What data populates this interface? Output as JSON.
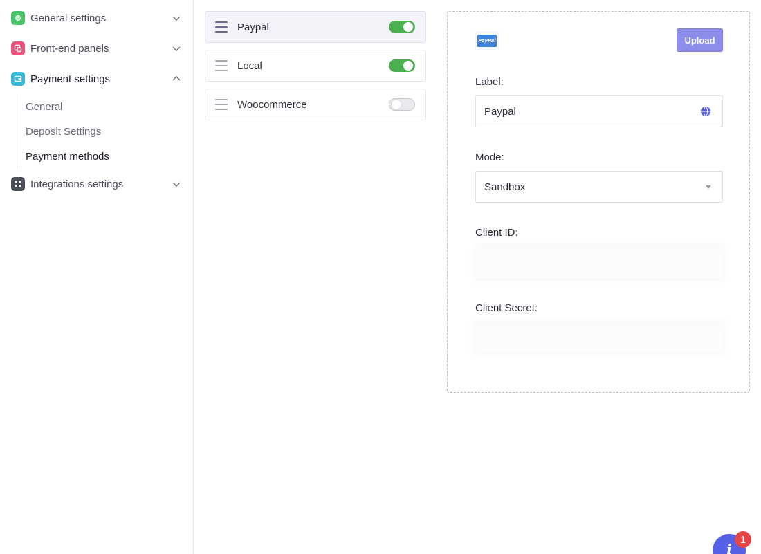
{
  "sidebar": {
    "groups": [
      {
        "label": "General settings",
        "icon": "gear-icon",
        "color": "#4cc36b",
        "expanded": false
      },
      {
        "label": "Front-end panels",
        "icon": "panels-icon",
        "color": "#f0507a",
        "expanded": false
      },
      {
        "label": "Payment settings",
        "icon": "wallet-icon",
        "color": "#35b9d6",
        "expanded": true
      },
      {
        "label": "Integrations settings",
        "icon": "puzzle-icon",
        "color": "#4a4f5a",
        "expanded": false
      }
    ],
    "payment_sub": [
      {
        "label": "General"
      },
      {
        "label": "Deposit Settings"
      },
      {
        "label": "Payment methods"
      }
    ]
  },
  "methods": [
    {
      "label": "Paypal",
      "enabled": true,
      "selected": true
    },
    {
      "label": "Local",
      "enabled": true,
      "selected": false
    },
    {
      "label": "Woocommerce",
      "enabled": false,
      "selected": false
    }
  ],
  "panel": {
    "logo_text": "PayPal",
    "upload_label": "Upload",
    "label_field": {
      "label": "Label:",
      "value": "Paypal"
    },
    "mode_field": {
      "label": "Mode:",
      "value": "Sandbox"
    },
    "client_id": {
      "label": "Client ID:",
      "value": ""
    },
    "client_secret": {
      "label": "Client Secret:",
      "value": ""
    }
  },
  "help": {
    "icon": "info-icon",
    "badge_count": "1",
    "color": "#5560e6"
  },
  "colors": {
    "toggle_on": "#4caf50",
    "accent": "#8c8cea"
  }
}
